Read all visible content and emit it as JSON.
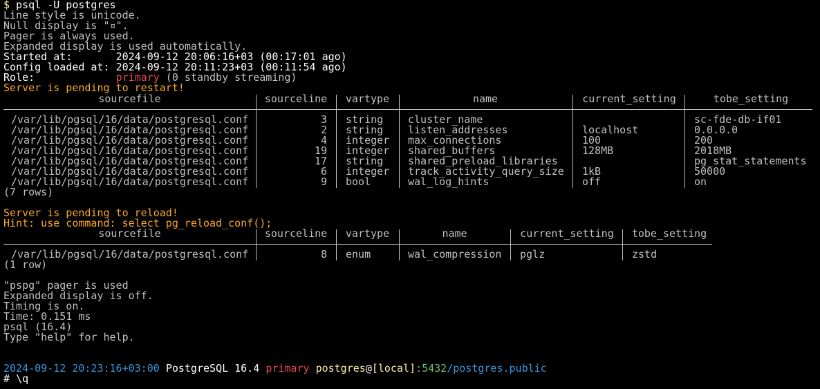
{
  "prompt_cmd": {
    "sigil": "$",
    "command": " psql -U postgres"
  },
  "startup": {
    "line_style": "Line style is unicode.",
    "null_display": "Null display is \"¤\".",
    "pager": "Pager is always used.",
    "expanded": "Expanded display is used automatically.",
    "started_label": "Started at:       ",
    "started_value": "2024-09-12 20:06:16+03 (00:17:01 ago)",
    "config_label": "Config loaded at: ",
    "config_value": "2024-09-12 20:11:23+03 (00:11:54 ago)",
    "role_label": "Role:             ",
    "role_value": "primary",
    "role_extra": " (0 standby streaming)",
    "restart_msg": "Server is pending to restart!"
  },
  "table1": {
    "headers": [
      "sourcefile",
      "sourceline",
      "vartype",
      "name",
      "current_setting",
      "tobe_setting"
    ],
    "rows": [
      [
        "/var/lib/pgsql/16/data/postgresql.conf",
        "3",
        "string",
        "cluster_name",
        "",
        "sc-fde-db-if01"
      ],
      [
        "/var/lib/pgsql/16/data/postgresql.conf",
        "2",
        "string",
        "listen_addresses",
        "localhost",
        "0.0.0.0"
      ],
      [
        "/var/lib/pgsql/16/data/postgresql.conf",
        "4",
        "integer",
        "max_connections",
        "100",
        "200"
      ],
      [
        "/var/lib/pgsql/16/data/postgresql.conf",
        "19",
        "integer",
        "shared_buffers",
        "128MB",
        "2018MB"
      ],
      [
        "/var/lib/pgsql/16/data/postgresql.conf",
        "17",
        "string",
        "shared_preload_libraries",
        "",
        "pg_stat_statements"
      ],
      [
        "/var/lib/pgsql/16/data/postgresql.conf",
        "6",
        "integer",
        "track_activity_query_size",
        "1kB",
        "50000"
      ],
      [
        "/var/lib/pgsql/16/data/postgresql.conf",
        "9",
        "bool",
        "wal_log_hints",
        "off",
        "on"
      ]
    ],
    "count": "(7 rows)"
  },
  "reload_msg": "Server is pending to reload!",
  "reload_hint": "Hint: use command: select pg_reload_conf();",
  "table2": {
    "headers": [
      "sourcefile",
      "sourceline",
      "vartype",
      "name",
      "current_setting",
      "tobe_setting"
    ],
    "rows": [
      [
        "/var/lib/pgsql/16/data/postgresql.conf",
        "8",
        "enum",
        "wal_compression",
        "pglz",
        "zstd"
      ]
    ],
    "count": "(1 row)"
  },
  "footer": {
    "pager": "\"pspg\" pager is used",
    "expanded": "Expanded display is off.",
    "timing": "Timing is on.",
    "time": "Time: 0.151 ms",
    "version": "psql (16.4)",
    "help": "Type \"help\" for help."
  },
  "prompt": {
    "timestamp": "2024-09-12 20:23:16+03:00",
    "server": "PostgreSQL 16.4",
    "role": "primary",
    "user": "postgres",
    "at": "@",
    "host": "[local]",
    "port": ":5432",
    "db": "/postgres.public",
    "sigil": "# ",
    "input": "\\q"
  },
  "colors": {
    "background": "#000000",
    "text": "#c0c0c0",
    "timestamp": "#3a96dd",
    "role": "#e74856",
    "user": "#f9f1a5",
    "port": "#6fc16f",
    "warning": "#f9a825"
  }
}
